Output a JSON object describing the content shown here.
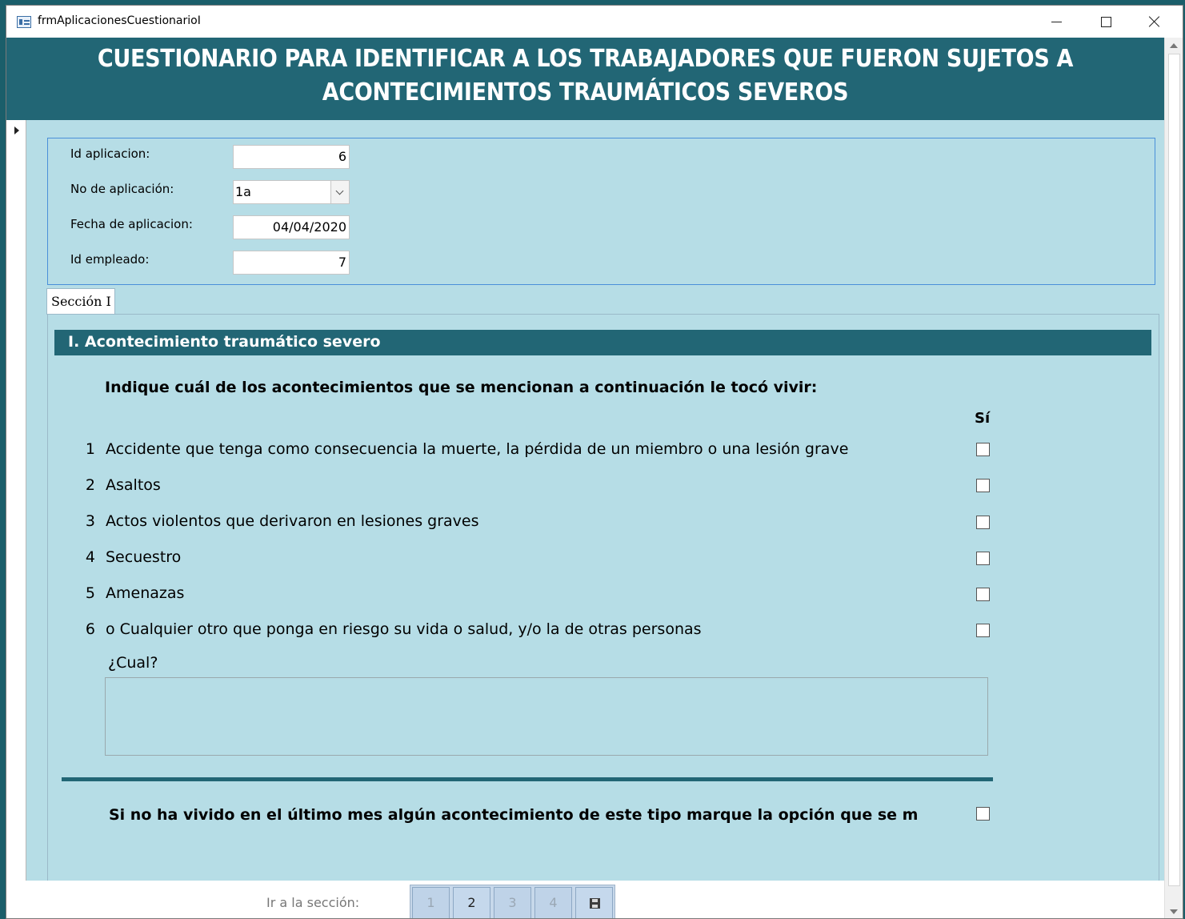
{
  "window": {
    "title": "frmAplicacionesCuestionarioI"
  },
  "header": {
    "title_line1": "CUESTIONARIO PARA IDENTIFICAR A LOS TRABAJADORES QUE FUERON SUJETOS A",
    "title_line2": "ACONTECIMIENTOS TRAUMÁTICOS SEVEROS"
  },
  "fields": {
    "id_aplicacion": {
      "label": "Id aplicacion:",
      "value": "6"
    },
    "no_aplicacion": {
      "label": "No de aplicación:",
      "value": "1a"
    },
    "fecha_aplicacion": {
      "label": "Fecha de aplicacion:",
      "value": "04/04/2020"
    },
    "id_empleado": {
      "label": "Id empleado:",
      "value": "7"
    }
  },
  "tab": {
    "label": "Sección I"
  },
  "section": {
    "title": "I. Acontecimiento traumático severo",
    "instruction": "Indique cuál de los acontecimientos que se mencionan a continuación le tocó vivir:",
    "yes_header": "Sí",
    "questions": [
      {
        "num": "1",
        "text": "Accidente que tenga como consecuencia la muerte, la pérdida de un miembro o una lesión grave",
        "checked": false
      },
      {
        "num": "2",
        "text": "Asaltos",
        "checked": false
      },
      {
        "num": "3",
        "text": "Actos violentos que derivaron en lesiones graves",
        "checked": false
      },
      {
        "num": "4",
        "text": "Secuestro",
        "checked": false
      },
      {
        "num": "5",
        "text": "Amenazas",
        "checked": false
      },
      {
        "num": "6",
        "text": "o Cualquier otro que ponga en riesgo su vida o salud, y/o la de otras personas",
        "checked": false
      }
    ],
    "cual_label": "¿Cual?",
    "cual_value": "",
    "no_lived_text": "Si no ha vivido en el último mes algún acontecimiento de este tipo marque la opción que se muestra ac",
    "no_lived_checked": false
  },
  "footer": {
    "goto_label": "Ir a la sección:",
    "buttons": [
      "1",
      "2",
      "3",
      "4"
    ]
  }
}
